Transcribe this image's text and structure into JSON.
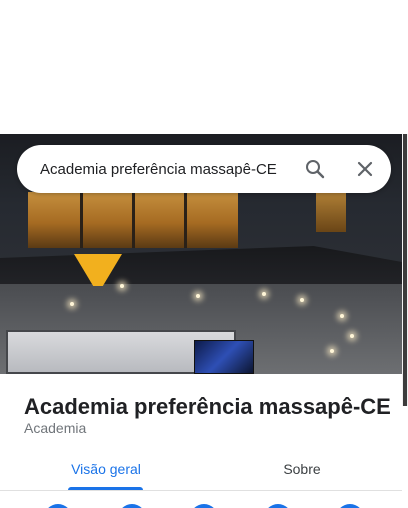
{
  "search": {
    "value": "Academia preferência massapê-CE",
    "search_icon": "search-icon",
    "close_icon": "close-icon"
  },
  "place": {
    "title": "Academia preferência massapê-CE",
    "category": "Academia"
  },
  "tabs": [
    {
      "label": "Visão geral",
      "active": true
    },
    {
      "label": "Sobre",
      "active": false
    }
  ],
  "colors": {
    "accent": "#1a73e8",
    "title_text": "#202124",
    "secondary_text": "#70757a"
  }
}
